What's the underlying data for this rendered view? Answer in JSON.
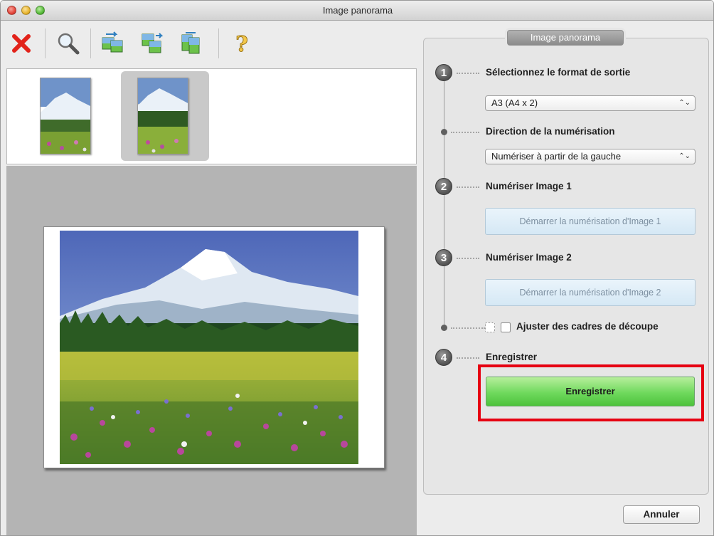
{
  "window": {
    "title": "Image panorama"
  },
  "toolbar": {
    "items": [
      {
        "icon": "delete-icon",
        "color": "#e2231a"
      },
      {
        "icon": "zoom-icon"
      },
      {
        "icon": "swap-images-icon"
      },
      {
        "icon": "rotate-image-icon"
      },
      {
        "icon": "flip-image-icon"
      },
      {
        "icon": "help-icon",
        "glyph": "?"
      }
    ]
  },
  "thumbnails": {
    "selected_index": 1,
    "count": 2
  },
  "panel": {
    "title": "Image panorama",
    "step1": {
      "number": "1",
      "label": "Sélectionnez le format de sortie",
      "select_value": "A3 (A4 x 2)"
    },
    "direction": {
      "label": "Direction de la numérisation",
      "select_value": "Numériser à partir de la gauche"
    },
    "step2": {
      "number": "2",
      "label": "Numériser Image 1",
      "button_label": "Démarrer la numérisation d'Image 1"
    },
    "step3": {
      "number": "3",
      "label": "Numériser Image 2",
      "button_label": "Démarrer la numérisation d'Image 2"
    },
    "crop": {
      "label": "Ajuster des cadres de découpe",
      "checked": false
    },
    "step4": {
      "number": "4",
      "label": "Enregistrer",
      "button_label": "Enregistrer",
      "highlight_color": "#e60012"
    }
  },
  "footer": {
    "cancel_label": "Annuler"
  },
  "select_arrows": "⌃⌄"
}
